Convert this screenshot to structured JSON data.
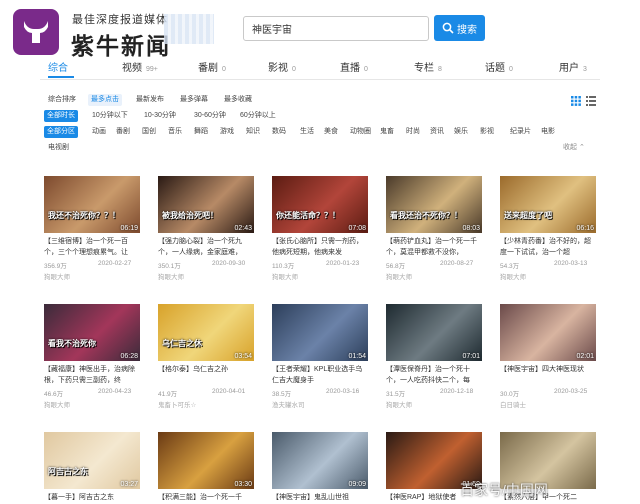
{
  "header": {
    "brand_subtitle": "最佳深度报道媒体",
    "brand_name": "紫牛新闻",
    "search_value": "神医宇宙",
    "search_button": "搜索",
    "colors": {
      "brand_purple": "#7a2a8a",
      "accent_blue": "#1a8ae6"
    }
  },
  "tabs": [
    {
      "label": "综合",
      "count": ""
    },
    {
      "label": "视频",
      "count": "99+"
    },
    {
      "label": "番剧",
      "count": "0"
    },
    {
      "label": "影视",
      "count": "0"
    },
    {
      "label": "直播",
      "count": "0"
    },
    {
      "label": "专栏",
      "count": "8"
    },
    {
      "label": "话题",
      "count": "0"
    },
    {
      "label": "用户",
      "count": "3"
    }
  ],
  "sort": [
    "综合排序",
    "最多点击",
    "最新发布",
    "最多弹幕",
    "最多收藏"
  ],
  "duration": [
    "全部时长",
    "10分钟以下",
    "10-30分钟",
    "30-60分钟",
    "60分钟以上"
  ],
  "partitions": [
    "全部分区",
    "动画",
    "番剧",
    "国创",
    "音乐",
    "舞蹈",
    "游戏",
    "知识",
    "数码",
    "生活",
    "美食",
    "动物圈",
    "鬼畜",
    "时尚",
    "资讯",
    "娱乐",
    "影视",
    "纪录片",
    "电影"
  ],
  "partitions_row2": [
    "电视剧"
  ],
  "collapse_label": "收起 ⌃",
  "cards": [
    {
      "caption": "我还不治死你？？！",
      "duration": "06:19",
      "title_a": "【三维宿博】治一个死一百个，三个个理想痕累气。让",
      "views": "356.9万",
      "date": "2020-02-27",
      "author": "狗眼大师",
      "colors": [
        "#7d4a2e",
        "#c99a6b"
      ]
    },
    {
      "caption": "被我给治死吧！",
      "duration": "02:43",
      "title_a": "【强力脑心裂】治一个死九个，一人缘病，金家庭难，",
      "views": "350.1万",
      "date": "2020-09-30",
      "author": "狗眼大师",
      "colors": [
        "#2a1a14",
        "#b78a66"
      ]
    },
    {
      "caption": "你还能活命？？！",
      "duration": "07:08",
      "title_a": "【张氏心脑所】只需一剂药，他病死短期，他病来发",
      "views": "110.3万",
      "date": "2020-01-23",
      "author": "狗眼大师",
      "colors": [
        "#5b1c12",
        "#b2453a"
      ]
    },
    {
      "caption": "看我还治不死你？！",
      "duration": "08:03",
      "title_a": "【萌药铲血丸】治一个死一千个，莫混甲都救不没你，",
      "views": "56.8万",
      "date": "2020-08-27",
      "author": "狗眼大师",
      "colors": [
        "#4a3a2a",
        "#d0b17c"
      ]
    },
    {
      "caption": "送来超度了吧",
      "duration": "06:16",
      "title_a": "【少林青药番】治不好的，超度一下试试，治一个超",
      "views": "54.3万",
      "date": "2020-03-13",
      "author": "狗眼大师",
      "colors": [
        "#9b6b2c",
        "#e0c080"
      ]
    },
    {
      "caption": "看我不治死你",
      "duration": "06:28",
      "title_a": "【藏福康】神医出手，治病除根，下药只需三副药，终",
      "views": "46.6万",
      "date": "2020-04-23",
      "author": "狗眼大师",
      "colors": [
        "#3a2b3a",
        "#a3365a"
      ]
    },
    {
      "caption": "乌仁吉之休",
      "duration": "03:54",
      "title_a": "【格尔泰】乌仁吉之孙",
      "views": "41.9万",
      "date": "2020-04-01",
      "author": "鬼畜卜可乐☆",
      "colors": [
        "#d8a22a",
        "#f0d67a"
      ]
    },
    {
      "caption": "",
      "duration": "01:54",
      "title_a": "【王者荣耀】KPL职业选手乌仁吉大魔身手",
      "views": "38.5万",
      "date": "2020-03-16",
      "author": "渔夫罐水司",
      "colors": [
        "#2c3e5a",
        "#6b82a8"
      ]
    },
    {
      "caption": "",
      "duration": "07:01",
      "title_a": "【潭医保脊丹】治一个死十个，一人吃药抖快二个，每",
      "views": "31.5万",
      "date": "2020-12-18",
      "author": "狗眼大师",
      "colors": [
        "#1e2a30",
        "#6e7b82"
      ]
    },
    {
      "caption": "",
      "duration": "02:01",
      "title_a": "【神医宇宙】四大神医现状",
      "views": "30.0万",
      "date": "2020-03-25",
      "author": "白日骑士",
      "colors": [
        "#6b4a4a",
        "#d8b4a0"
      ]
    },
    {
      "caption": "阿吉古之东",
      "duration": "03:27",
      "title_a": "【暮一手】阿吉古之东",
      "views": "",
      "date": "",
      "author": "",
      "colors": [
        "#e0c8a0",
        "#f4e8d0"
      ]
    },
    {
      "caption": "",
      "duration": "03:30",
      "title_a": "【积满三能】治一个死一千",
      "views": "",
      "date": "",
      "author": "",
      "colors": [
        "#6a3a14",
        "#d8a040"
      ]
    },
    {
      "caption": "",
      "duration": "09:09",
      "title_a": "【神医宇宙】鬼乱山世祖",
      "views": "",
      "date": "",
      "author": "",
      "colors": [
        "#4a5a6a",
        "#b0c0d0"
      ]
    },
    {
      "caption": "",
      "duration": "01:59",
      "title_a": "【神医RAP】地狱使者",
      "views": "",
      "date": "",
      "author": "",
      "colors": [
        "#2a1a14",
        "#c06030"
      ]
    },
    {
      "caption": "",
      "duration": "",
      "title_a": "【素然六层】甲一个死二",
      "views": "",
      "date": "",
      "author": "",
      "colors": [
        "#7a6a4a",
        "#d4c4a0"
      ]
    }
  ],
  "watermark": "百家号/中国网"
}
